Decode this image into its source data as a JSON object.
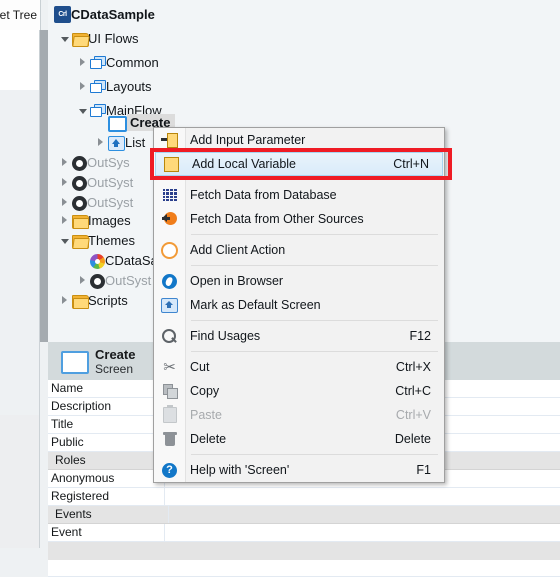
{
  "left_panel": {
    "tab_label": "get Tree"
  },
  "tree": {
    "items": [
      {
        "label": "CDataSample",
        "icon": "module-badge-icon",
        "badge_text": "Crl",
        "indent": 0,
        "toggle": "none",
        "style": "normal"
      },
      {
        "label": "UI Flows",
        "icon": "folder-open-icon",
        "indent": 1,
        "toggle": "open",
        "style": "normal"
      },
      {
        "label": "Common",
        "icon": "ui-flow-icon",
        "indent": 2,
        "toggle": "closed",
        "style": "normal"
      },
      {
        "label": "Layouts",
        "icon": "ui-flow-icon",
        "indent": 2,
        "toggle": "closed",
        "style": "normal"
      },
      {
        "label": "MainFlow",
        "icon": "ui-flow-icon",
        "indent": 2,
        "toggle": "open",
        "style": "normal"
      },
      {
        "label": "Create",
        "icon": "screen-icon",
        "indent": 3,
        "toggle": "none",
        "style": "selected"
      },
      {
        "label": "List",
        "icon": "home-screen-icon",
        "indent": 3,
        "toggle": "closed",
        "style": "normal"
      },
      {
        "label": "OutSys",
        "icon": "module-icon",
        "indent": 1,
        "toggle": "closed",
        "style": "dim"
      },
      {
        "label": "OutSyst",
        "icon": "module-icon",
        "indent": 1,
        "toggle": "closed",
        "style": "dim"
      },
      {
        "label": "OutSyst",
        "icon": "module-icon",
        "indent": 1,
        "toggle": "closed",
        "style": "dim"
      },
      {
        "label": "Images",
        "icon": "folder-icon",
        "indent": 1,
        "toggle": "closed",
        "style": "normal"
      },
      {
        "label": "Themes",
        "icon": "folder-open-icon",
        "indent": 1,
        "toggle": "open",
        "style": "normal"
      },
      {
        "label": "CDataSa",
        "icon": "theme-icon",
        "indent": 2,
        "toggle": "none",
        "style": "normal"
      },
      {
        "label": "OutSyst",
        "icon": "module-icon",
        "indent": 2,
        "toggle": "closed",
        "style": "dim"
      },
      {
        "label": "Scripts",
        "icon": "folder-icon",
        "indent": 1,
        "toggle": "closed",
        "style": "normal"
      }
    ]
  },
  "context_menu": {
    "items": [
      {
        "type": "item",
        "label": "Add Input Parameter",
        "shortcut": "",
        "icon": "add-input-parameter-icon",
        "state": "normal"
      },
      {
        "type": "item",
        "label": "Add Local Variable",
        "shortcut": "Ctrl+N",
        "icon": "add-local-variable-icon",
        "state": "selected"
      },
      {
        "type": "separator"
      },
      {
        "type": "item",
        "label": "Fetch Data from Database",
        "shortcut": "",
        "icon": "database-icon",
        "state": "normal"
      },
      {
        "type": "item",
        "label": "Fetch Data from Other Sources",
        "shortcut": "",
        "icon": "fetch-other-sources-icon",
        "state": "normal"
      },
      {
        "type": "separator"
      },
      {
        "type": "item",
        "label": "Add Client Action",
        "shortcut": "",
        "icon": "client-action-icon",
        "state": "normal"
      },
      {
        "type": "separator"
      },
      {
        "type": "item",
        "label": "Open in Browser",
        "shortcut": "",
        "icon": "open-in-browser-icon",
        "state": "normal"
      },
      {
        "type": "item",
        "label": "Mark as Default Screen",
        "shortcut": "",
        "icon": "default-screen-icon",
        "state": "normal"
      },
      {
        "type": "separator"
      },
      {
        "type": "item",
        "label": "Find Usages",
        "shortcut": "F12",
        "icon": "search-icon",
        "state": "normal"
      },
      {
        "type": "separator"
      },
      {
        "type": "item",
        "label": "Cut",
        "shortcut": "Ctrl+X",
        "icon": "cut-icon",
        "state": "normal"
      },
      {
        "type": "item",
        "label": "Copy",
        "shortcut": "Ctrl+C",
        "icon": "copy-icon",
        "state": "normal"
      },
      {
        "type": "item",
        "label": "Paste",
        "shortcut": "Ctrl+V",
        "icon": "paste-icon",
        "state": "disabled"
      },
      {
        "type": "item",
        "label": "Delete",
        "shortcut": "Delete",
        "icon": "trash-icon",
        "state": "normal"
      },
      {
        "type": "separator"
      },
      {
        "type": "item",
        "label": "Help with 'Screen'",
        "shortcut": "F1",
        "icon": "help-icon",
        "state": "normal"
      }
    ],
    "highlight_color": "#ef1b24"
  },
  "properties": {
    "title": "Create",
    "subtitle": "Screen",
    "help_label": "?",
    "rows": [
      {
        "name": "Name",
        "value": "",
        "type": "field"
      },
      {
        "name": "Description",
        "value": "",
        "type": "field"
      },
      {
        "name": "Title",
        "value": "",
        "type": "field"
      },
      {
        "name": "Public",
        "value": "",
        "type": "field"
      },
      {
        "name": "Roles",
        "value": "",
        "type": "group"
      },
      {
        "name": "Anonymous",
        "value": "",
        "type": "field"
      },
      {
        "name": "Registered",
        "value": "",
        "type": "field"
      },
      {
        "name": "Events",
        "value": "",
        "type": "group"
      },
      {
        "name": "Event",
        "value": "",
        "type": "field"
      }
    ]
  }
}
